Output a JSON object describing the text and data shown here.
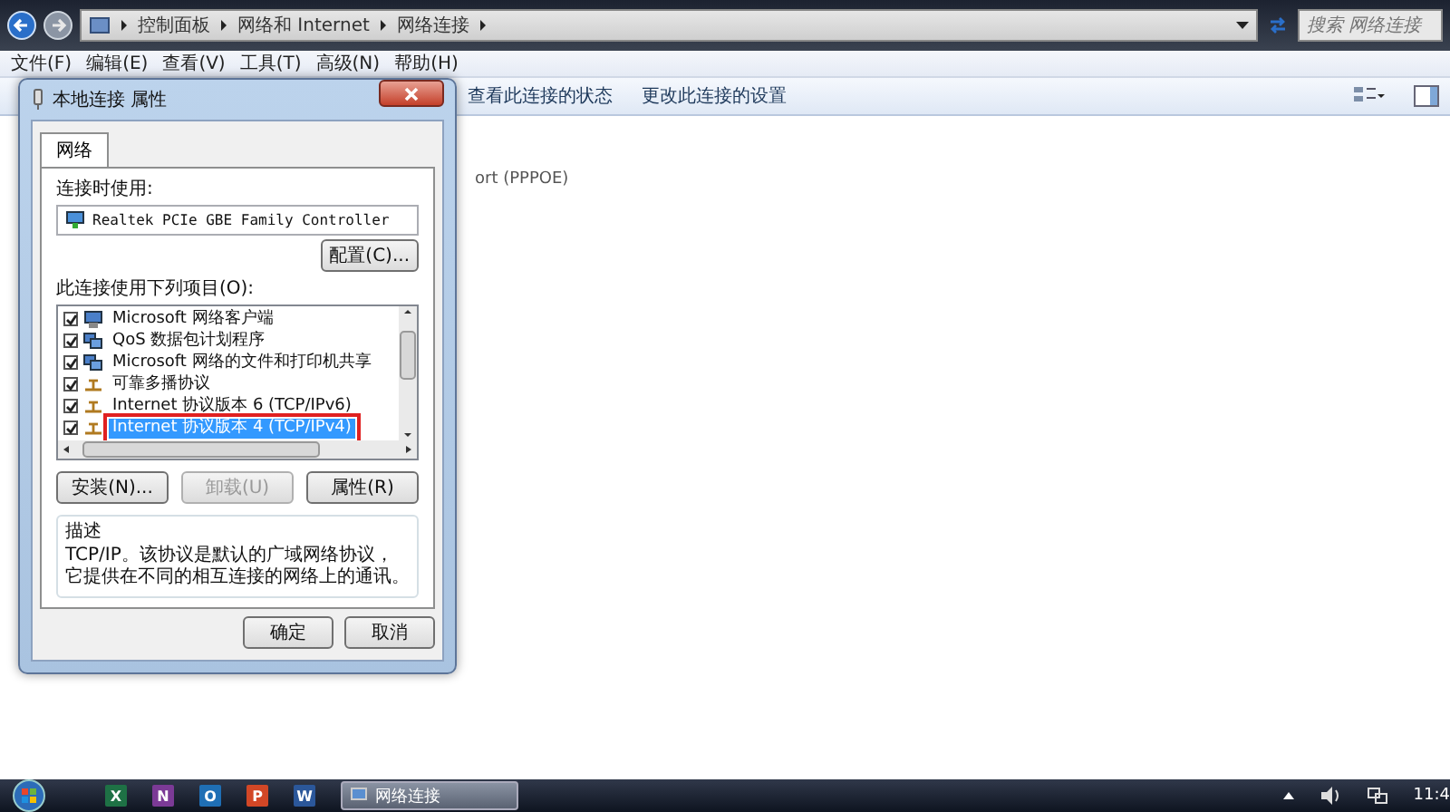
{
  "explorer": {
    "breadcrumb": [
      "控制面板",
      "网络和 Internet",
      "网络连接"
    ],
    "search": {
      "placeholder": "搜索 网络连接"
    },
    "menu": [
      "文件(F)",
      "编辑(E)",
      "查看(V)",
      "工具(T)",
      "高级(N)",
      "帮助(H)"
    ],
    "toolbar": [
      "查看此连接的状态",
      "更改此连接的设置"
    ],
    "items": [
      "ort (PPPOE)"
    ]
  },
  "dialog": {
    "title": "本地连接 属性",
    "tabs": [
      {
        "label": "网络",
        "selected": true
      }
    ],
    "connect_using_label": "连接时使用:",
    "adapter": "Realtek PCIe GBE Family Controller",
    "configure_button": "配置(C)...",
    "items_label": "此连接使用下列项目(O):",
    "items": [
      {
        "kind": "client",
        "label": "Microsoft 网络客户端",
        "checked": true,
        "selected": false
      },
      {
        "kind": "service",
        "label": "QoS 数据包计划程序",
        "checked": true,
        "selected": false
      },
      {
        "kind": "service",
        "label": "Microsoft 网络的文件和打印机共享",
        "checked": true,
        "selected": false
      },
      {
        "kind": "protocol",
        "label": "可靠多播协议",
        "checked": true,
        "selected": false
      },
      {
        "kind": "protocol",
        "label": "Internet 协议版本 6 (TCP/IPv6)",
        "checked": true,
        "selected": false
      },
      {
        "kind": "protocol",
        "label": "Internet 协议版本 4 (TCP/IPv4)",
        "checked": true,
        "selected": true
      }
    ],
    "buttons": [
      {
        "label": "安装(N)...",
        "disabled": false
      },
      {
        "label": "卸载(U)",
        "disabled": true
      },
      {
        "label": "属性(R)",
        "disabled": false
      }
    ],
    "description_label": "描述",
    "description": "TCP/IP。该协议是默认的广域网络协议，它提供在不同的相互连接的网络上的通讯。",
    "footer_buttons": [
      "确定",
      "取消"
    ]
  },
  "taskbar": {
    "apps": [
      {
        "letter": "X",
        "color": "#1e7145"
      },
      {
        "letter": "N",
        "color": "#7b3a96"
      },
      {
        "letter": "O",
        "color": "#1f6fb5"
      },
      {
        "letter": "P",
        "color": "#d24726"
      },
      {
        "letter": "W",
        "color": "#2b579a"
      }
    ],
    "window_button": "网络连接",
    "clock": "11:4"
  }
}
